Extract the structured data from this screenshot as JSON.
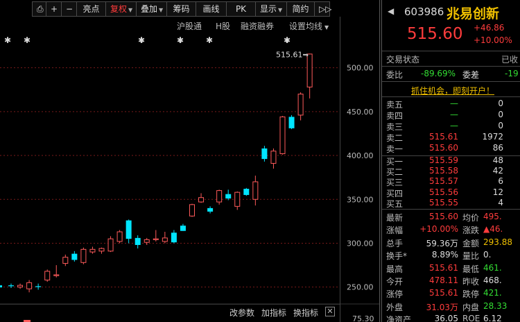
{
  "toolbar": {
    "items": [
      {
        "label": "⎙"
      },
      {
        "label": "+"
      },
      {
        "label": "−"
      },
      {
        "label": "亮点"
      },
      {
        "label": "复权",
        "dropdown": true,
        "active": true
      },
      {
        "label": "叠加",
        "dropdown": true
      },
      {
        "label": "筹码"
      },
      {
        "label": "画线"
      },
      {
        "label": "PK"
      },
      {
        "label": "显示",
        "dropdown": true
      },
      {
        "label": "简约"
      },
      {
        "label": "▷▷"
      }
    ]
  },
  "chart_links": [
    "沪股通",
    "H股",
    "融资融券",
    "设置均线"
  ],
  "chart_data": {
    "type": "candlestick",
    "y_ticks": [
      "500.00",
      "450.00",
      "400.00",
      "350.00",
      "300.00",
      "250.00",
      "75.30"
    ],
    "ylim": [
      245,
      525
    ],
    "max_label": "515.61",
    "up_color": "#ff5a5a",
    "down_color": "#00e5ff",
    "candles": [
      {
        "o": 252,
        "h": 254,
        "l": 249,
        "c": 251
      },
      {
        "o": 250,
        "h": 254,
        "l": 248,
        "c": 252
      },
      {
        "o": 248,
        "h": 258,
        "l": 244,
        "c": 255
      },
      {
        "o": 251,
        "h": 254,
        "l": 247,
        "c": 250
      },
      {
        "o": 258,
        "h": 270,
        "l": 256,
        "c": 268
      },
      {
        "o": 263,
        "h": 275,
        "l": 261,
        "c": 264
      },
      {
        "o": 277,
        "h": 287,
        "l": 274,
        "c": 284
      },
      {
        "o": 288,
        "h": 291,
        "l": 279,
        "c": 281
      },
      {
        "o": 278,
        "h": 295,
        "l": 276,
        "c": 293
      },
      {
        "o": 290,
        "h": 296,
        "l": 288,
        "c": 293
      },
      {
        "o": 291,
        "h": 295,
        "l": 288,
        "c": 294
      },
      {
        "o": 291,
        "h": 308,
        "l": 290,
        "c": 305
      },
      {
        "o": 302,
        "h": 315,
        "l": 300,
        "c": 313
      },
      {
        "o": 326,
        "h": 327,
        "l": 300,
        "c": 305
      },
      {
        "o": 306,
        "h": 309,
        "l": 294,
        "c": 298
      },
      {
        "o": 301,
        "h": 306,
        "l": 298,
        "c": 304
      },
      {
        "o": 304,
        "h": 315,
        "l": 302,
        "c": 305
      },
      {
        "o": 302,
        "h": 313,
        "l": 300,
        "c": 306
      },
      {
        "o": 312,
        "h": 315,
        "l": 300,
        "c": 301
      },
      {
        "o": 320,
        "h": 322,
        "l": 314,
        "c": 314
      },
      {
        "o": 331,
        "h": 345,
        "l": 330,
        "c": 344
      },
      {
        "o": 347,
        "h": 357,
        "l": 346,
        "c": 352
      },
      {
        "o": 340,
        "h": 342,
        "l": 334,
        "c": 336
      },
      {
        "o": 347,
        "h": 361,
        "l": 344,
        "c": 360
      },
      {
        "o": 356,
        "h": 361,
        "l": 349,
        "c": 351
      },
      {
        "o": 342,
        "h": 359,
        "l": 338,
        "c": 358
      },
      {
        "o": 362,
        "h": 363,
        "l": 354,
        "c": 355
      },
      {
        "o": 350,
        "h": 377,
        "l": 343,
        "c": 370
      },
      {
        "o": 408,
        "h": 411,
        "l": 393,
        "c": 396
      },
      {
        "o": 391,
        "h": 408,
        "l": 385,
        "c": 405
      },
      {
        "o": 402,
        "h": 445,
        "l": 401,
        "c": 444
      },
      {
        "o": 444,
        "h": 446,
        "l": 430,
        "c": 431
      },
      {
        "o": 446,
        "h": 472,
        "l": 440,
        "c": 470
      },
      {
        "o": 478,
        "h": 516,
        "l": 465,
        "c": 515.6
      }
    ],
    "marker_x": [
      11,
      39,
      204,
      260,
      302,
      414
    ]
  },
  "chart_bottom": {
    "buttons": [
      "改参数",
      "加指标",
      "换指标"
    ],
    "close_icon": "close-icon"
  },
  "quote": {
    "code": "603986",
    "name": "兆易创新",
    "price": "515.60",
    "change": "+46.86",
    "change_pct": "+10.00%",
    "status_label": "交易状态",
    "status_value": "已收",
    "weibi_label": "委比",
    "weibi_value": "-89.69%",
    "weicha_label": "委差",
    "weicha_value": "-19",
    "promo": "抓住机会，即刻开户！",
    "asks": [
      {
        "label": "卖五",
        "price": "—",
        "vol": "0"
      },
      {
        "label": "卖四",
        "price": "—",
        "vol": "0"
      },
      {
        "label": "卖三",
        "price": "—",
        "vol": "0"
      },
      {
        "label": "卖二",
        "price": "515.61",
        "vol": "1972"
      },
      {
        "label": "卖一",
        "price": "515.60",
        "vol": "86"
      }
    ],
    "bids": [
      {
        "label": "买一",
        "price": "515.59",
        "vol": "48"
      },
      {
        "label": "买二",
        "price": "515.58",
        "vol": "42"
      },
      {
        "label": "买三",
        "price": "515.57",
        "vol": "6"
      },
      {
        "label": "买四",
        "price": "515.56",
        "vol": "12"
      },
      {
        "label": "买五",
        "price": "515.55",
        "vol": "4"
      }
    ],
    "stats": [
      {
        "l1": "最新",
        "v1": "515.60",
        "c1": "red",
        "l2": "均价",
        "v2": "495.",
        "c2": "red"
      },
      {
        "l1": "涨幅",
        "v1": "+10.00%",
        "c1": "red",
        "l2": "涨跌",
        "v2": "▲46.",
        "c2": "red"
      },
      {
        "l1": "总手",
        "v1": "59.36万",
        "c1": "white",
        "l2": "金额",
        "v2": "293.88",
        "c2": "yellow"
      },
      {
        "l1": "换手*",
        "v1": "8.89%",
        "c1": "white",
        "l2": "量比",
        "v2": "0.",
        "c2": "white"
      },
      {
        "l1": "最高",
        "v1": "515.61",
        "c1": "red",
        "l2": "最低",
        "v2": "461.",
        "c2": "green"
      },
      {
        "l1": "今开",
        "v1": "478.11",
        "c1": "red",
        "l2": "昨收",
        "v2": "468.",
        "c2": "white"
      },
      {
        "l1": "涨停",
        "v1": "515.61",
        "c1": "red",
        "l2": "跌停",
        "v2": "421.",
        "c2": "green"
      },
      {
        "l1": "外盘",
        "v1": "31.03万",
        "c1": "red",
        "l2": "内盘",
        "v2": "28.33",
        "c2": "green"
      },
      {
        "l1": "净资产",
        "v1": "36.05",
        "c1": "white",
        "l2": "ROE",
        "v2": "6.12",
        "c2": "white"
      }
    ]
  }
}
